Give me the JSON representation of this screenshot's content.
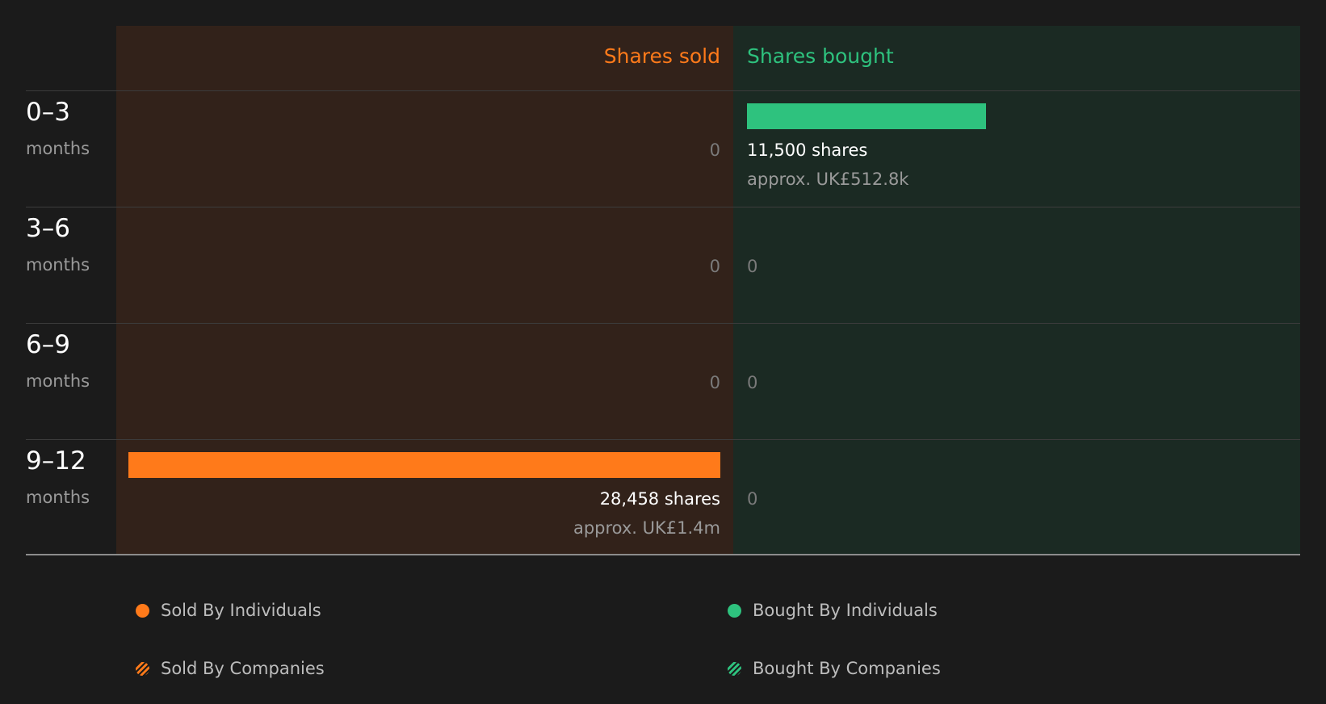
{
  "chart_data": {
    "type": "bar",
    "orientation": "diverging-horizontal",
    "header": {
      "sold": "Shares sold",
      "bought": "Shares bought"
    },
    "rows": [
      {
        "period": "0–3",
        "unit": "months",
        "sold": {
          "value": 0,
          "label": "0"
        },
        "bought": {
          "value": 11500,
          "label": "11,500 shares",
          "approx": "approx. UK£512.8k"
        }
      },
      {
        "period": "3–6",
        "unit": "months",
        "sold": {
          "value": 0,
          "label": "0"
        },
        "bought": {
          "value": 0,
          "label": "0"
        }
      },
      {
        "period": "6–9",
        "unit": "months",
        "sold": {
          "value": 0,
          "label": "0"
        },
        "bought": {
          "value": 0,
          "label": "0"
        }
      },
      {
        "period": "9–12",
        "unit": "months",
        "sold": {
          "value": 28458,
          "label": "28,458 shares",
          "approx": "approx. UK£1.4m"
        },
        "bought": {
          "value": 0,
          "label": "0"
        }
      }
    ],
    "legend": [
      {
        "label": "Sold By Individuals",
        "color": "#ff7a1a",
        "style": "solid"
      },
      {
        "label": "Bought By Individuals",
        "color": "#2ec27e",
        "style": "solid"
      },
      {
        "label": "Sold By Companies",
        "color": "#ff7a1a",
        "style": "hatched"
      },
      {
        "label": "Bought By Companies",
        "color": "#2ec27e",
        "style": "hatched"
      }
    ],
    "colors": {
      "sold": "#ff7a1a",
      "bought": "#2ec27e",
      "sold_bg": "#32221a",
      "bought_bg": "#1b2a23"
    }
  }
}
